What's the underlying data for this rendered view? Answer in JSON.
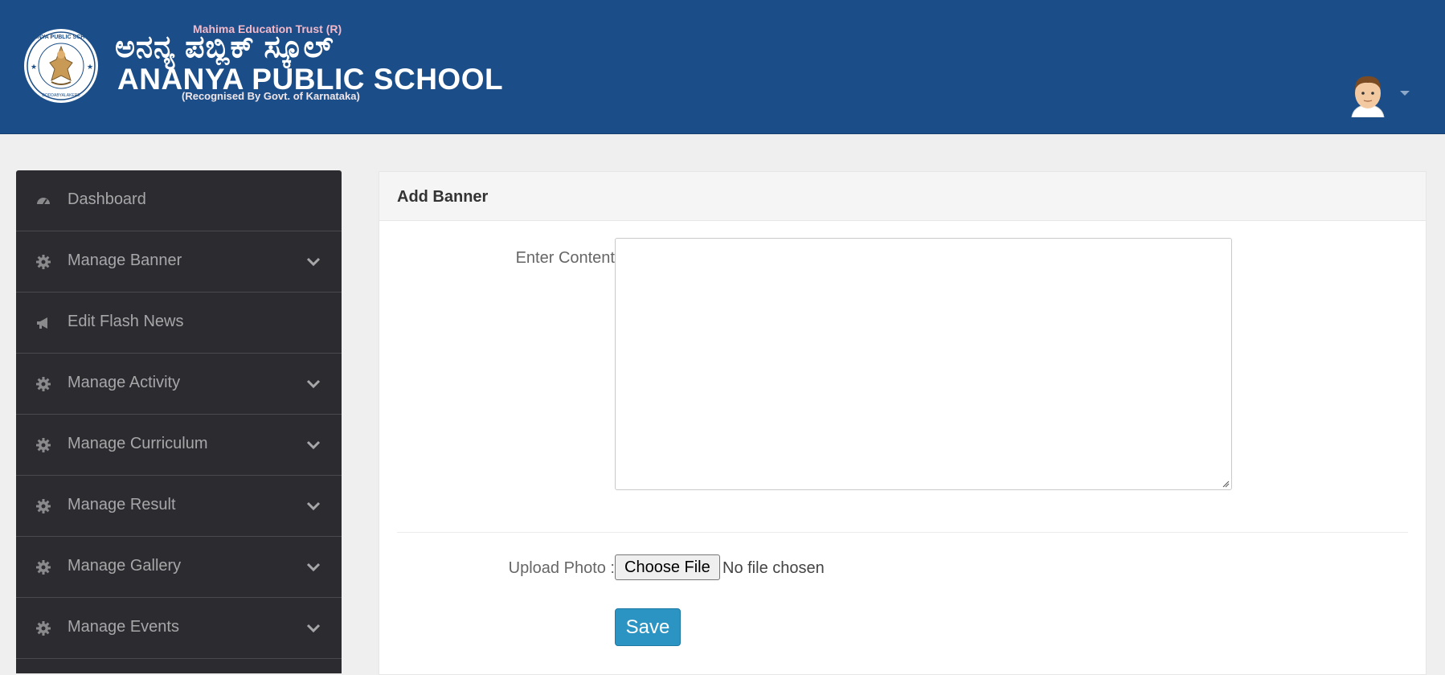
{
  "header": {
    "trust": "Mahima Education Trust (R)",
    "kannada_name": "ಅನನ್ಯ ಪಬ್ಲಿಕ್ ಸ್ಕೂಲ್",
    "school_name": "ANANYA PUBLIC SCHOOL",
    "recognised": "(Recognised By Govt. of Karnataka)",
    "seal_text": "ANANYA PUBLIC SCHOOL",
    "seal_motto": "KNOWLEDGE IS POWER",
    "seal_place": "DODDABYALAKERE, B'LORE-89"
  },
  "sidebar": {
    "items": [
      {
        "label": "Dashboard",
        "icon": "dashboard-icon",
        "expandable": false
      },
      {
        "label": "Manage Banner",
        "icon": "gear-icon",
        "expandable": true
      },
      {
        "label": "Edit Flash News",
        "icon": "megaphone-icon",
        "expandable": false
      },
      {
        "label": "Manage Activity",
        "icon": "gear-icon",
        "expandable": true
      },
      {
        "label": "Manage Curriculum",
        "icon": "gear-icon",
        "expandable": true
      },
      {
        "label": "Manage Result",
        "icon": "gear-icon",
        "expandable": true
      },
      {
        "label": "Manage Gallery",
        "icon": "gear-icon",
        "expandable": true
      },
      {
        "label": "Manage Events",
        "icon": "gear-icon",
        "expandable": true
      }
    ]
  },
  "form": {
    "title": "Add Banner",
    "content_label": "Enter Content",
    "content_value": "",
    "upload_label": "Upload Photo :",
    "choose_file": "Choose File",
    "file_status": "No file chosen",
    "save": "Save"
  },
  "colors": {
    "header_bg": "#1b4e88",
    "sidebar_bg": "#2c2b2f",
    "save_button": "#2c94c2"
  }
}
